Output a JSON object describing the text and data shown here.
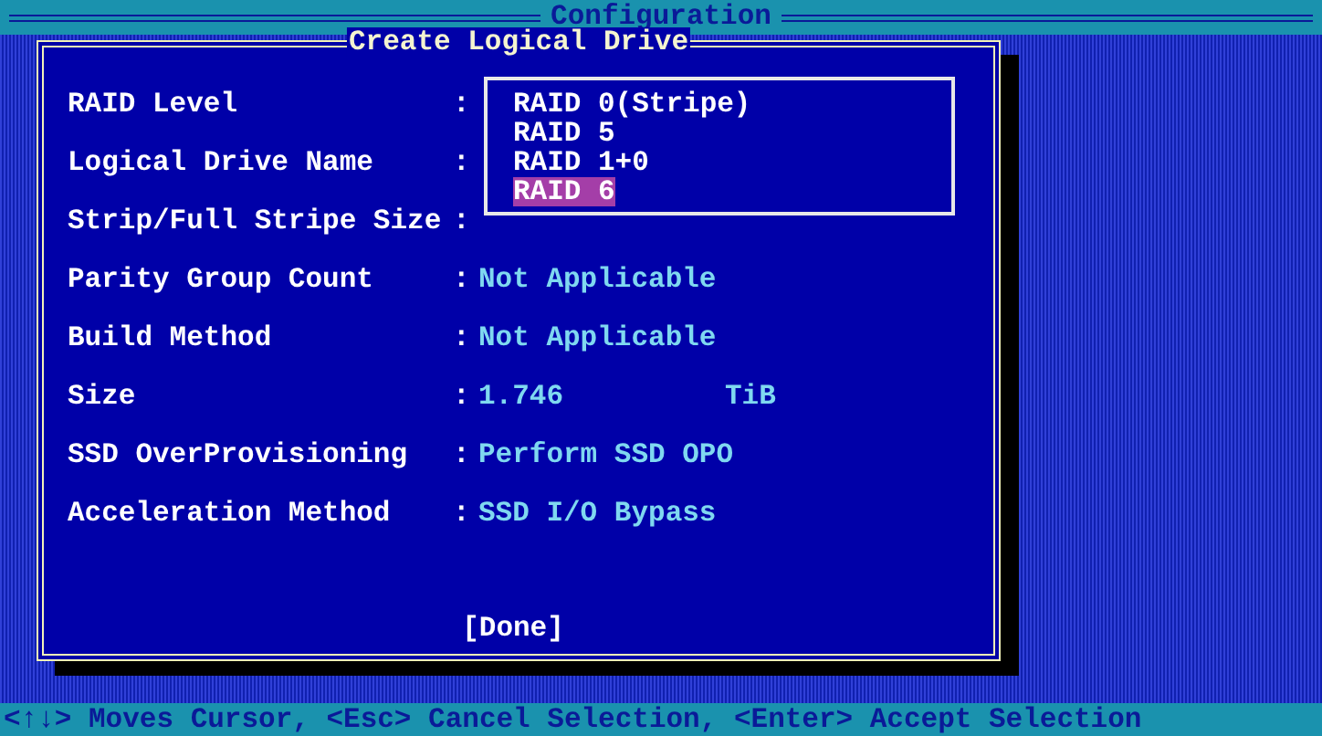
{
  "header": {
    "title": "Configuration"
  },
  "dialog": {
    "title": "Create Logical Drive",
    "fields": [
      {
        "label": "RAID Level",
        "colon": ":"
      },
      {
        "label": "Logical Drive Name",
        "colon": ":"
      },
      {
        "label": "Strip/Full Stripe Size",
        "colon": ":"
      },
      {
        "label": "Parity Group Count",
        "colon": ":",
        "value": "Not Applicable"
      },
      {
        "label": "Build Method",
        "colon": ":",
        "value": "Not Applicable"
      },
      {
        "label": "Size",
        "colon": ":",
        "value": "1.746",
        "unit": "TiB"
      },
      {
        "label": "SSD OverProvisioning",
        "colon": ":",
        "value": "Perform SSD OPO"
      },
      {
        "label": "Acceleration Method",
        "colon": ":",
        "value": "SSD I/O Bypass"
      }
    ],
    "done_button": "[Done]"
  },
  "popup": {
    "options": [
      {
        "label": "RAID 0(Stripe)",
        "selected": false
      },
      {
        "label": "RAID 5",
        "selected": false
      },
      {
        "label": "RAID 1+0",
        "selected": false
      },
      {
        "label": "RAID 6",
        "selected": true
      }
    ]
  },
  "status_bar": "<↑↓> Moves Cursor, <Esc> Cancel Selection, <Enter> Accept Selection"
}
